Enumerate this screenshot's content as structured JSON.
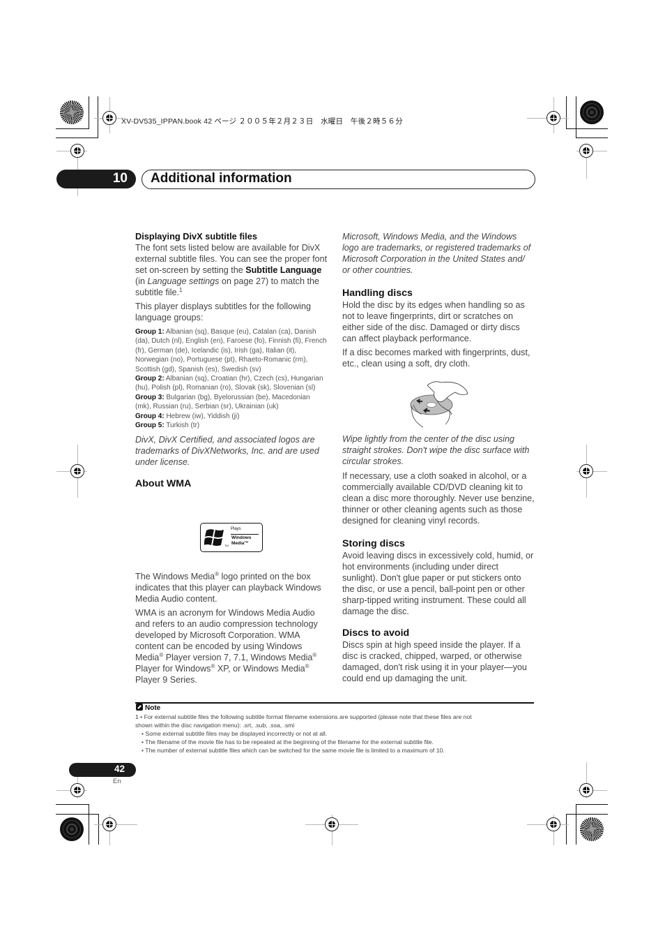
{
  "print_header": {
    "text": "XV-DV535_IPPAN.book  42 ページ  ２００５年２月２３日　水曜日　午後２時５６分"
  },
  "chapter": {
    "number": "10",
    "title": "Additional information"
  },
  "left_column": {
    "divx": {
      "heading": "Displaying DivX subtitle files",
      "para1_a": "The font sets listed below are available for DivX external subtitle files. You can see the proper font set on-screen by setting the ",
      "para1_bold": "Subtitle Language",
      "para1_b": " (in ",
      "para1_italic": "Language settings",
      "para1_c": " on page 27) to match the subtitle file.",
      "para1_footnote": "1",
      "para2": "This player displays subtitles for the following language groups:",
      "groups": [
        {
          "label": "Group 1:",
          "languages": " Albanian (sq), Basque (eu), Catalan (ca), Danish (da), Dutch (nl), English (en), Faroese (fo), Finnish (fi), French (fr), German (de), Icelandic (is), Irish (ga), Italian (it), Norwegian (no), Portuguese (pt), Rhaeto-Romanic (rm), Scottish (gd), Spanish (es), Swedish (sv)"
        },
        {
          "label": "Group 2:",
          "languages": " Albanian (sq), Croatian (hr), Czech (cs), Hungarian (hu), Polish (pl), Romanian (ro), Slovak (sk), Slovenian (sl)"
        },
        {
          "label": "Group 3:",
          "languages": " Bulgarian (bg), Byelorussian (be), Macedonian (mk), Russian (ru), Serbian (sr), Ukrainian (uk)"
        },
        {
          "label": "Group 4:",
          "languages": " Hebrew (iw), Yiddish (ji)"
        },
        {
          "label": "Group 5:",
          "languages": " Turkish (tr)"
        }
      ],
      "trademark": "DivX, DivX Certified, and associated logos are trademarks of DivXNetworks, Inc. and are used under license."
    },
    "wma": {
      "heading": "About WMA",
      "logo": {
        "plays": "Plays",
        "line1": "Windows",
        "line2": "Media™",
        "tm": "TM"
      },
      "para1_a": "The Windows Media",
      "para1_b": " logo printed on the box indicates that this player can playback Windows Media Audio content.",
      "para2_a": "WMA is an acronym for Windows Media Audio and refers to an audio compression technology developed by Microsoft Corporation. WMA content can be encoded by using Windows Media",
      "para2_b": " Player version 7, 7.1, Windows Media",
      "para2_c": " Player for Windows",
      "para2_d": " XP, or Windows Media",
      "para2_e": " Player 9 Series.",
      "reg_mark": "®"
    }
  },
  "right_column": {
    "ms_trademark": "Microsoft, Windows Media, and the Windows logo are trademarks, or registered trademarks of Microsoft Corporation in the United States and/ or other countries.",
    "handling": {
      "heading": "Handling discs",
      "para1": "Hold the disc by its edges when handling so as not to leave fingerprints, dirt or scratches on either side of the disc. Damaged or dirty discs can affect playback performance.",
      "para2": "If a disc becomes marked with fingerprints, dust, etc., clean using a soft, dry cloth.",
      "caption": "Wipe lightly from the center of the disc using straight strokes. Don't wipe the disc surface with circular strokes.",
      "para3": "If necessary, use a cloth soaked in alcohol, or a commercially available CD/DVD cleaning kit to clean a disc more thoroughly. Never use benzine, thinner or other cleaning agents such as those designed for cleaning vinyl records."
    },
    "storing": {
      "heading": "Storing discs",
      "para": "Avoid leaving discs in excessively cold, humid, or hot environments (including under direct sunlight). Don't glue paper or put stickers onto the disc, or use a pencil, ball-point pen or other sharp-tipped writing instrument. These could all damage the disc."
    },
    "avoid": {
      "heading": "Discs to avoid",
      "para": "Discs spin at high speed inside the player. If a disc is cracked, chipped, warped, or otherwise damaged, don't risk using it in your player—you could end up damaging the unit."
    }
  },
  "note": {
    "heading": "Note",
    "lines": [
      "1  • For external subtitle files the following subtitle format filename extensions are supported (please note that these files are not",
      "shown within the disc navigation menu): .srt, .sub, .ssa, .smi",
      "• Some external subtitle files may be displayed incorrectly or not at all.",
      "• The filename of the movie file has to be repeated at the beginning of the filename for the external subtitle file.",
      "• The number of external subtitle files which can be switched for the same movie file is limited to a maximum of 10."
    ]
  },
  "footer": {
    "page_number": "42",
    "language": "En"
  }
}
